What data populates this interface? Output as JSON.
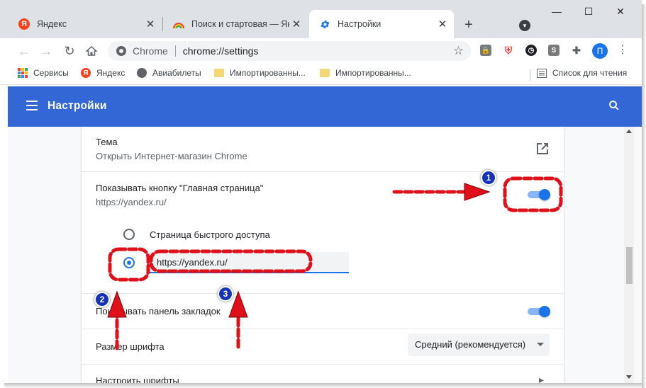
{
  "tabs": [
    {
      "label": "Яндекс",
      "icon": "yandex-icon",
      "active": false
    },
    {
      "label": "Поиск и стартовая — Янд",
      "icon": "rainbow-icon",
      "active": false
    },
    {
      "label": "Настройки",
      "icon": "settings-gear-icon",
      "active": true
    }
  ],
  "window": {
    "minimize": "—",
    "maximize": "☐",
    "close": "✕",
    "new_tab": "+"
  },
  "omnibox": {
    "scheme_label": "Chrome",
    "url": "chrome://settings"
  },
  "profile": {
    "initial": "П"
  },
  "extensions": {
    "ext4_letter": "S"
  },
  "bookmarks": [
    {
      "label": "Сервисы",
      "icon": "apps-grid-icon"
    },
    {
      "label": "Яндекс",
      "icon": "yandex-icon"
    },
    {
      "label": "Авиабилеты",
      "icon": "globe-icon"
    },
    {
      "label": "Импортированны...",
      "icon": "folder-icon"
    },
    {
      "label": "Импортированны...",
      "icon": "folder-icon"
    }
  ],
  "reading_list": "Список для чтения",
  "header": {
    "title": "Настройки"
  },
  "settings": {
    "theme": {
      "title": "Тема",
      "subtitle": "Открыть Интернет-магазин Chrome"
    },
    "home_button": {
      "title": "Показывать кнопку \"Главная страница\"",
      "subtitle": "https://yandex.ru/",
      "enabled": true
    },
    "home_options": {
      "new_tab_label": "Страница быстрого доступа",
      "custom_url_value": "https://yandex.ru/",
      "selected": "custom"
    },
    "bookmarks_bar": {
      "title": "Показывать панель закладок",
      "enabled": true
    },
    "font_size": {
      "title": "Размер шрифта",
      "value": "Средний (рекомендуется)"
    },
    "customize_fonts": {
      "title": "Настроить шрифты"
    }
  },
  "annotations": {
    "badge1": "1",
    "badge2": "2",
    "badge3": "3"
  },
  "colors": {
    "header_blue": "#3367d6",
    "toggle_blue": "#1a73e8",
    "annotation_red": "#e0101a",
    "badge_blue": "#1433b8"
  }
}
